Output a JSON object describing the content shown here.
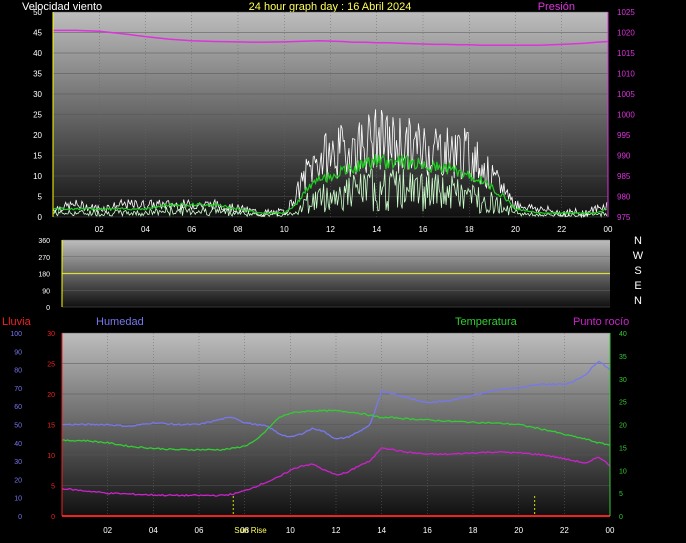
{
  "header": {
    "title": "24 hour graph day : 16 Abril 2024",
    "left_label": "Velocidad viento",
    "right_label": "Presión"
  },
  "compass": [
    "N",
    "W",
    "S",
    "E",
    "N"
  ],
  "lower_labels": {
    "rain": "Lluvia",
    "humidity": "Humedad",
    "temperature": "Temperatura",
    "dewpoint": "Punto rocío",
    "sunrise": "Sun Rise"
  },
  "colors": {
    "wind": "#ffffff",
    "wind_avg": "#22cc22",
    "wind_min": "#ccffcc",
    "pressure": "#dd33dd",
    "direction": "#dddd33",
    "humidity": "#7777ee",
    "temperature": "#33cc33",
    "dewpoint": "#cc22cc",
    "rain": "#ee2222",
    "marker": "#dddd00"
  },
  "chart_data": [
    {
      "type": "line",
      "title": "24 hour graph day : 16 Abril 2024",
      "x_ticks": [
        "02",
        "04",
        "06",
        "08",
        "10",
        "12",
        "14",
        "16",
        "18",
        "20",
        "22",
        "00"
      ],
      "x": [
        0,
        1,
        2,
        3,
        4,
        5,
        6,
        7,
        8,
        9,
        10,
        10.5,
        11,
        11.5,
        12,
        12.5,
        13,
        13.5,
        14,
        14.5,
        15,
        15.5,
        16,
        16.5,
        17,
        17.5,
        18,
        18.5,
        19,
        19.5,
        20,
        21,
        22,
        23,
        23.5,
        24
      ],
      "xlim": [
        0,
        24
      ],
      "series": [
        {
          "name": "Velocidad viento",
          "axis": "left",
          "ylim": [
            0,
            50
          ],
          "values": [
            2,
            3,
            2,
            3,
            3,
            3,
            3,
            3,
            2,
            1,
            1,
            5,
            11,
            14,
            15,
            16,
            17,
            18,
            19,
            18,
            18,
            17,
            17,
            17,
            16,
            16,
            15,
            13,
            9,
            7,
            3,
            2,
            1,
            1,
            2,
            3
          ]
        },
        {
          "name": "",
          "axis": "left",
          "ylim": [
            0,
            50
          ],
          "values": [
            2,
            2,
            2,
            2,
            2,
            3,
            3,
            3,
            2,
            1,
            1,
            3,
            7,
            9,
            10,
            11,
            12,
            13,
            14,
            13,
            14,
            13,
            13,
            12,
            12,
            11,
            10,
            9,
            7,
            5,
            2,
            1,
            1,
            1,
            1,
            2
          ]
        },
        {
          "name": "Presión",
          "axis": "right",
          "ylim": [
            975,
            1025
          ],
          "values": [
            1020.5,
            1020.5,
            1020.3,
            1019.7,
            1019.0,
            1018.4,
            1018.0,
            1017.8,
            1017.7,
            1017.6,
            1017.7,
            1017.8,
            1017.9,
            1018.0,
            1017.9,
            1017.8,
            1017.6,
            1017.6,
            1017.5,
            1017.5,
            1017.4,
            1017.3,
            1017.2,
            1017.1,
            1017.1,
            1017.0,
            1017.0,
            1016.9,
            1016.9,
            1016.9,
            1016.9,
            1016.9,
            1017.1,
            1017.4,
            1017.6,
            1017.8
          ]
        }
      ],
      "y_left_ticks": [
        "0",
        "5",
        "10",
        "15",
        "20",
        "25",
        "30",
        "35",
        "40",
        "45",
        "50"
      ],
      "y_right_ticks": [
        "975",
        "980",
        "985",
        "990",
        "995",
        "1000",
        "1005",
        "1010",
        "1015",
        "1020",
        "1025"
      ],
      "xlabel": "",
      "ylabel": ""
    },
    {
      "type": "line",
      "x": [
        0,
        24
      ],
      "xlim": [
        0,
        24
      ],
      "ylim": [
        0,
        360
      ],
      "y_ticks": [
        "0",
        "90",
        "180",
        "270",
        "360"
      ],
      "series": [
        {
          "name": "",
          "values": [
            180,
            180
          ]
        }
      ],
      "xlabel": "",
      "ylabel": ""
    },
    {
      "type": "line",
      "x_ticks": [
        "02",
        "04",
        "06",
        "08",
        "10",
        "12",
        "14",
        "16",
        "18",
        "20",
        "22",
        "00"
      ],
      "x": [
        0,
        1,
        2,
        3,
        4,
        5,
        6,
        7,
        7.5,
        8,
        8.5,
        9,
        9.5,
        10,
        10.5,
        11,
        11.5,
        12,
        12.5,
        13,
        13.5,
        14,
        14.5,
        15,
        16,
        17,
        18,
        19,
        20,
        21,
        21.5,
        22,
        22.5,
        23,
        23.5,
        24
      ],
      "xlim": [
        0,
        24
      ],
      "y_left_outer_ticks": [
        "0",
        "10",
        "20",
        "30",
        "40",
        "50",
        "60",
        "70",
        "80",
        "90",
        "100"
      ],
      "y_left_inner_ticks": [
        "0",
        "5",
        "10",
        "15",
        "20",
        "25",
        "30"
      ],
      "y_right_ticks": [
        "0",
        "5",
        "10",
        "15",
        "20",
        "25",
        "30",
        "35",
        "40"
      ],
      "series": [
        {
          "name": "Humedad",
          "axis": "humidity",
          "ylim": [
            0,
            100
          ],
          "values": [
            50,
            50,
            50,
            49,
            51,
            50,
            50,
            53,
            54,
            51,
            50,
            49,
            45,
            43,
            45,
            48,
            46,
            42,
            43,
            46,
            50,
            68,
            67,
            65,
            62,
            63,
            66,
            69,
            70,
            72,
            72,
            72,
            74,
            78,
            85,
            80
          ]
        },
        {
          "name": "Temperatura",
          "axis": "temperature",
          "ylim": [
            0,
            40
          ],
          "values": [
            16.5,
            16.5,
            16,
            15.2,
            14.8,
            14.5,
            14.5,
            14.5,
            14.8,
            15.3,
            16.5,
            19,
            21.5,
            22.5,
            22.8,
            23,
            23,
            23,
            22.8,
            22.5,
            22,
            21.5,
            21.5,
            21.3,
            21,
            20.7,
            20.5,
            20.3,
            20,
            19,
            18.5,
            17.8,
            17.3,
            16.7,
            16,
            15.5
          ]
        },
        {
          "name": "Punto rocío",
          "axis": "temperature",
          "ylim": [
            0,
            40
          ],
          "values": [
            6,
            5.5,
            5,
            4.8,
            4.6,
            4.5,
            4.5,
            4.5,
            4.8,
            5.5,
            6.5,
            7.5,
            8.5,
            10,
            11,
            11.3,
            10,
            9,
            9.5,
            11,
            12,
            15,
            14.5,
            14,
            13.5,
            13.5,
            13.8,
            14,
            13.8,
            13.4,
            13,
            12.5,
            12,
            11.5,
            13,
            11
          ]
        },
        {
          "name": "Lluvia",
          "axis": "rain",
          "ylim": [
            0,
            30
          ],
          "values": [
            0,
            0,
            0,
            0,
            0,
            0,
            0,
            0,
            0,
            0,
            0,
            0,
            0,
            0,
            0,
            0,
            0,
            0,
            0,
            0,
            0,
            0,
            0,
            0,
            0,
            0,
            0,
            0,
            0,
            0,
            0,
            0,
            0,
            0,
            0,
            0
          ]
        }
      ],
      "markers": [
        {
          "label": "Sun Rise",
          "x": 7.5
        },
        {
          "label": "",
          "x": 20.7
        }
      ],
      "xlabel": "",
      "ylabel": ""
    }
  ]
}
